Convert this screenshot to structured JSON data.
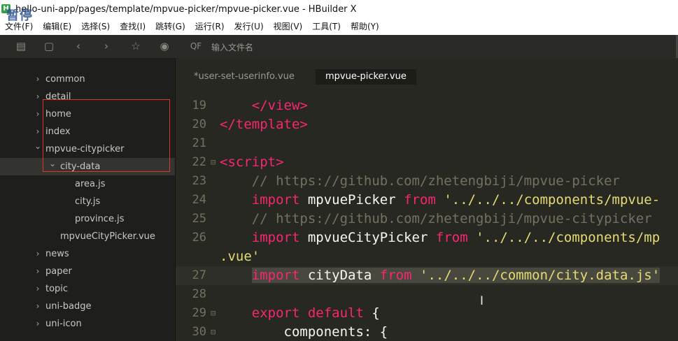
{
  "window": {
    "icon_letter": "H",
    "title": "hello-uni-app/pages/template/mpvue-picker/mpvue-picker.vue - HBuilder X",
    "overlay_text": "暂停"
  },
  "menu": [
    "文件(F)",
    "编辑(E)",
    "选择(S)",
    "查找(I)",
    "跳转(G)",
    "运行(R)",
    "发行(U)",
    "视图(V)",
    "工具(T)",
    "帮助(Y)"
  ],
  "toolbar": {
    "search_placeholder": "输入文件名",
    "search_icon_label": "QF"
  },
  "sidebar": {
    "items": [
      {
        "label": "common",
        "indent": 1,
        "chevron": "right"
      },
      {
        "label": "detail",
        "indent": 1,
        "chevron": "right"
      },
      {
        "label": "home",
        "indent": 1,
        "chevron": "right"
      },
      {
        "label": "index",
        "indent": 1,
        "chevron": "right"
      },
      {
        "label": "mpvue-citypicker",
        "indent": 1,
        "chevron": "down"
      },
      {
        "label": "city-data",
        "indent": 2,
        "chevron": "down"
      },
      {
        "label": "area.js",
        "indent": 3,
        "chevron": "none"
      },
      {
        "label": "city.js",
        "indent": 3,
        "chevron": "none"
      },
      {
        "label": "province.js",
        "indent": 3,
        "chevron": "none"
      },
      {
        "label": "mpvueCityPicker.vue",
        "indent": 2,
        "chevron": "none"
      },
      {
        "label": "news",
        "indent": 1,
        "chevron": "right"
      },
      {
        "label": "paper",
        "indent": 1,
        "chevron": "right"
      },
      {
        "label": "topic",
        "indent": 1,
        "chevron": "right"
      },
      {
        "label": "uni-badge",
        "indent": 1,
        "chevron": "right"
      },
      {
        "label": "uni-icon",
        "indent": 1,
        "chevron": "right"
      }
    ],
    "selected_index": 5
  },
  "tabs": [
    {
      "label": "*user-set-userinfo.vue",
      "active": false
    },
    {
      "label": "mpvue-picker.vue",
      "active": true
    }
  ],
  "code": {
    "line_numbers": [
      "19",
      "20",
      "21",
      "22",
      "23",
      "24",
      "25",
      "26",
      "",
      "27",
      "28",
      "29",
      "30"
    ],
    "folds": [
      "",
      "",
      "",
      "⊟",
      "",
      "",
      "",
      "",
      "",
      "",
      "",
      "⊟",
      "⊟"
    ],
    "lines": [
      [
        {
          "t": "    </view>",
          "c": "tag"
        }
      ],
      [
        {
          "t": "</template>",
          "c": "tag"
        }
      ],
      [
        {
          "t": "",
          "c": "id"
        }
      ],
      [
        {
          "t": "<script>",
          "c": "tag"
        }
      ],
      [
        {
          "t": "    // https://github.com/zhetengbiji/mpvue-picker",
          "c": "cm"
        }
      ],
      [
        {
          "t": "    ",
          "c": "id"
        },
        {
          "t": "import",
          "c": "kw"
        },
        {
          "t": " mpvuePicker ",
          "c": "id"
        },
        {
          "t": "from",
          "c": "kw"
        },
        {
          "t": " '../../../components/mpvue-",
          "c": "str"
        }
      ],
      [
        {
          "t": "    // https://github.com/zhetengbiji/mpvue-citypicker",
          "c": "cm"
        }
      ],
      [
        {
          "t": "    ",
          "c": "id"
        },
        {
          "t": "import",
          "c": "kw"
        },
        {
          "t": " mpvueCityPicker ",
          "c": "id"
        },
        {
          "t": "from",
          "c": "kw"
        },
        {
          "t": " '../../../components/mp",
          "c": "str"
        }
      ],
      [
        {
          "t": ".vue'",
          "c": "str"
        }
      ],
      [
        {
          "t": "    ",
          "c": "id"
        },
        {
          "t": "import",
          "c": "kw",
          "sel": true
        },
        {
          "t": " cityData ",
          "c": "id",
          "sel": true
        },
        {
          "t": "from",
          "c": "kw",
          "sel": true
        },
        {
          "t": " '../../../common/city.data.js'",
          "c": "str",
          "sel": true
        }
      ],
      [
        {
          "t": "",
          "c": "id"
        }
      ],
      [
        {
          "t": "    ",
          "c": "id"
        },
        {
          "t": "export",
          "c": "kw"
        },
        {
          "t": " ",
          "c": "id"
        },
        {
          "t": "default",
          "c": "kw"
        },
        {
          "t": " {",
          "c": "id"
        }
      ],
      [
        {
          "t": "        components: {",
          "c": "id"
        }
      ]
    ],
    "current_line_index": 9
  }
}
